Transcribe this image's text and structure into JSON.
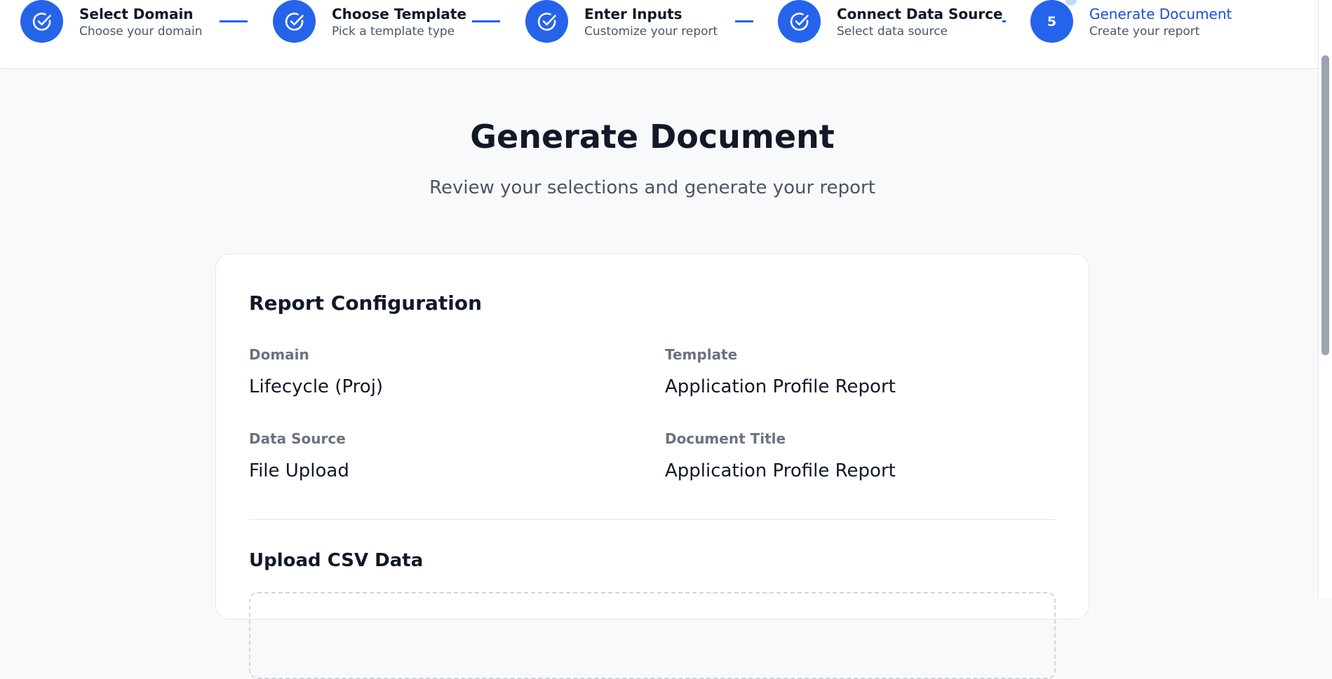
{
  "stepper": {
    "steps": [
      {
        "title": "Select Domain",
        "subtitle": "Choose your domain",
        "status": "completed"
      },
      {
        "title": "Choose Template",
        "subtitle": "Pick a template type",
        "status": "completed"
      },
      {
        "title": "Enter Inputs",
        "subtitle": "Customize your report",
        "status": "completed"
      },
      {
        "title": "Connect Data Source",
        "subtitle": "Select data source",
        "status": "completed"
      },
      {
        "title": "Generate Document",
        "subtitle": "Create your report",
        "status": "active",
        "number": "5"
      }
    ],
    "completed_icon": "check-circle-icon"
  },
  "page": {
    "title": "Generate Document",
    "subtitle": "Review your selections and generate your report"
  },
  "config": {
    "title": "Report Configuration",
    "fields": {
      "domain": {
        "label": "Domain",
        "value": "Lifecycle (Proj)"
      },
      "template": {
        "label": "Template",
        "value": "Application Profile Report"
      },
      "data_source": {
        "label": "Data Source",
        "value": "File Upload"
      },
      "document_title": {
        "label": "Document Title",
        "value": "Application Profile Report"
      }
    }
  },
  "upload": {
    "title": "Upload CSV Data"
  },
  "colors": {
    "accent": "#2563eb",
    "accent_dark": "#1d4ed8",
    "background": "#f8f9fa"
  }
}
